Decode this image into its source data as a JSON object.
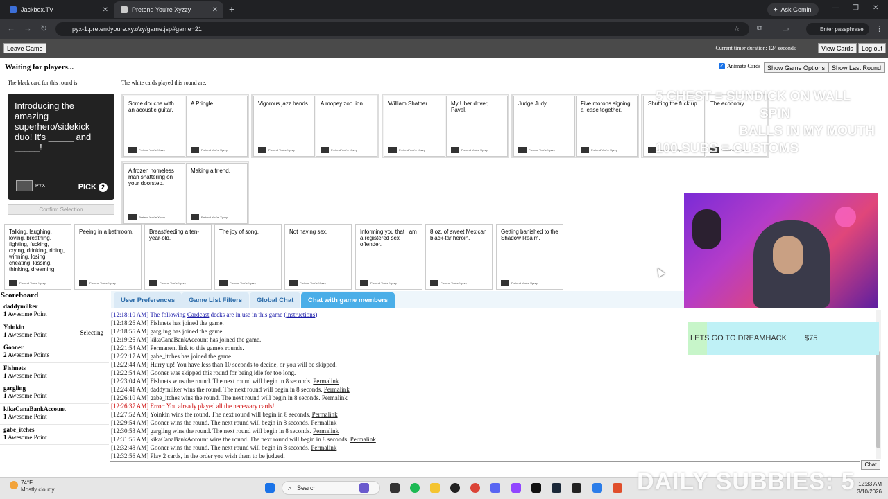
{
  "browser": {
    "tabs": [
      {
        "label": "Jackbox.TV"
      },
      {
        "label": "Pretend You're Xyzzy"
      }
    ],
    "url": "pyx-1.pretendyoure.xyz/zy/game.jsp#game=21",
    "ask_gemini": "Ask Gemini",
    "passphrase": "Enter passphrase"
  },
  "topbar": {
    "leave_game": "Leave Game",
    "timer": "Current timer duration: 124 seconds",
    "view_cards": "View Cards",
    "log_out": "Log out"
  },
  "game": {
    "status": "Waiting for players...",
    "black_caption": "The black card for this round is:",
    "white_caption": "The white cards played this round are:",
    "animate_cards": "Animate Cards",
    "show_options": "Show Game Options",
    "show_last_round": "Show Last Round",
    "black_card": {
      "text": "Introducing the amazing superhero/sidekick duo! It's _____ and _____!",
      "pick_label": "PICK",
      "pick_n": "2",
      "logo": "PYX"
    },
    "confirm": "Confirm Selection",
    "card_brand": "Pretend You're Xyzzy",
    "played": [
      [
        "Some douche with an acoustic guitar.",
        "A Pringle."
      ],
      [
        "Vigorous jazz hands.",
        "A mopey zoo lion."
      ],
      [
        "William Shatner.",
        "My Uber driver, Pavel."
      ],
      [
        "Judge Judy.",
        "Five morons signing a lease together."
      ],
      [
        "Shutting the fuck up.",
        "The economy."
      ],
      [
        "A frozen homeless man shattering on your doorstep.",
        "Making a friend."
      ]
    ],
    "hand": [
      "Talking, laughing, loving, breathing, fighting, fucking, crying, drinking, riding, winning, losing, cheating, kissing, thinking, dreaming.",
      "Peeing in a bathroom.",
      "Breastfeeding a ten-year-old.",
      "The joy of song.",
      "Not having sex.",
      "Informing you that I am a registered sex offender.",
      "8 oz. of sweet Mexican black-tar heroin.",
      "Getting banished to the Shadow Realm."
    ]
  },
  "scoreboard": {
    "title": "Scoreboard",
    "players": [
      {
        "name": "daddymilker",
        "points": "1",
        "label": "Awesome Point",
        "status": ""
      },
      {
        "name": "Yoinkin",
        "points": "1",
        "label": "Awesome Point",
        "status": "Selecting"
      },
      {
        "name": "Gooner",
        "points": "2",
        "label": "Awesome Points",
        "status": ""
      },
      {
        "name": "Fishnets",
        "points": "1",
        "label": "Awesome Point",
        "status": ""
      },
      {
        "name": "gargling",
        "points": "1",
        "label": "Awesome Point",
        "status": ""
      },
      {
        "name": "kikaCanaBankAccount",
        "points": "1",
        "label": "Awesome Point",
        "status": ""
      },
      {
        "name": "gabe_itches",
        "points": "1",
        "label": "Awesome Point",
        "status": ""
      }
    ]
  },
  "chat": {
    "tabs": [
      "User Preferences",
      "Game List Filters",
      "Global Chat",
      "Chat with game members"
    ],
    "lines": [
      {
        "t": "[12:18:10 AM]",
        "pre": " The following ",
        "link1": "Cardcast",
        "mid": " decks are in use in this game (",
        "link2": "instructions",
        "post": "):",
        "cls": "blue"
      },
      {
        "t": "[12:18:26 AM]",
        "pre": " Fishnets has joined the game.",
        "cls": ""
      },
      {
        "t": "[12:18:55 AM]",
        "pre": " gargling has joined the game.",
        "cls": ""
      },
      {
        "t": "[12:19:26 AM]",
        "pre": " kikaCanaBankAccount has joined the game.",
        "cls": ""
      },
      {
        "t": "[12:21:54 AM]",
        "pre": " ",
        "link1": "Permanent link to this game's rounds.",
        "cls": ""
      },
      {
        "t": "[12:22:17 AM]",
        "pre": " gabe_itches has joined the game.",
        "cls": ""
      },
      {
        "t": "[12:22:44 AM]",
        "pre": " Hurry up! You have less than 10 seconds to decide, or you will be skipped.",
        "cls": ""
      },
      {
        "t": "[12:22:54 AM]",
        "pre": " Gooner was skipped this round for being idle for too long.",
        "cls": ""
      },
      {
        "t": "[12:23:04 AM]",
        "pre": " Fishnets wins the round. The next round will begin in 8 seconds. ",
        "link1": "Permalink",
        "cls": ""
      },
      {
        "t": "[12:24:41 AM]",
        "pre": " daddymilker wins the round. The next round will begin in 8 seconds. ",
        "link1": "Permalink",
        "cls": ""
      },
      {
        "t": "[12:26:10 AM]",
        "pre": " gabe_itches wins the round. The next round will begin in 8 seconds. ",
        "link1": "Permalink",
        "cls": ""
      },
      {
        "t": "[12:26:37 AM]",
        "pre": " Error: You already played all the necessary cards!",
        "cls": "red"
      },
      {
        "t": "[12:27:52 AM]",
        "pre": " Yoinkin wins the round. The next round will begin in 8 seconds. ",
        "link1": "Permalink",
        "cls": ""
      },
      {
        "t": "[12:29:54 AM]",
        "pre": " Gooner wins the round. The next round will begin in 8 seconds. ",
        "link1": "Permalink",
        "cls": ""
      },
      {
        "t": "[12:30:53 AM]",
        "pre": " gargling wins the round. The next round will begin in 8 seconds. ",
        "link1": "Permalink",
        "cls": ""
      },
      {
        "t": "[12:31:55 AM]",
        "pre": " kikaCanaBankAccount wins the round. The next round will begin in 8 seconds. ",
        "link1": "Permalink",
        "cls": ""
      },
      {
        "t": "[12:32:48 AM]",
        "pre": " Gooner wins the round. The next round will begin in 8 seconds. ",
        "link1": "Permalink",
        "cls": ""
      },
      {
        "t": "[12:32:56 AM]",
        "pre": " Play 2 cards, in the order you wish them to be judged.",
        "cls": ""
      }
    ],
    "send": "Chat"
  },
  "overlay": {
    "lines": [
      "5 CHEST = SUNDICK ON WALL",
      "SPIN",
      "BALLS IN MY MOUTH",
      "100 SUBS = CUSTOMS"
    ],
    "donation_msg": "LETS GO TO DREAMHACK",
    "donation_amt": "$75",
    "subbies": "DAILY SUBBIES: 5"
  },
  "taskbar": {
    "temp": "74°F",
    "weather": "Mostly cloudy",
    "search": "Search",
    "time": "12:33 AM",
    "date": "3/10/2026"
  }
}
